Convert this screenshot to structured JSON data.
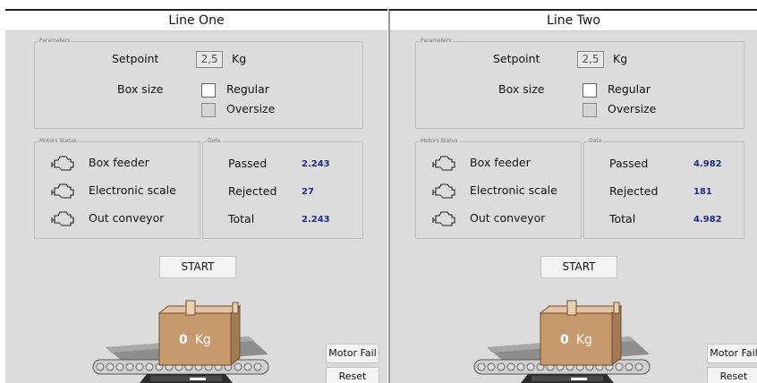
{
  "lines": [
    {
      "title": "Line One",
      "parameters_label": "Parameters",
      "setpoint_label": "Setpoint",
      "setpoint_value": "2,5",
      "setpoint_unit": "Kg",
      "box_size_label": "Box size",
      "box_options": [
        "Regular",
        "Oversize"
      ],
      "motors_label": "Motors Status",
      "motors": [
        "Box feeder",
        "Electronic scale",
        "Out conveyor"
      ],
      "motor_icon": "motor-icon",
      "data_label": "Data",
      "data_rows": [
        {
          "label": "Passed",
          "value": "2.243"
        },
        {
          "label": "Rejected",
          "value": "27"
        },
        {
          "label": "Total",
          "value": "2.243"
        }
      ],
      "start_label": "START",
      "box_weight": "0",
      "box_unit": "Kg",
      "motor_fail_label": "Motor Fail",
      "reset_label": "Reset"
    },
    {
      "title": "Line Two",
      "parameters_label": "Parameters",
      "setpoint_label": "Setpoint",
      "setpoint_value": "2,5",
      "setpoint_unit": "Kg",
      "box_size_label": "Box size",
      "box_options": [
        "Regular",
        "Oversize"
      ],
      "motors_label": "Motors Status",
      "motors": [
        "Box feeder",
        "Electronic scale",
        "Out conveyor"
      ],
      "motor_icon": "motor-icon",
      "data_label": "Data",
      "data_rows": [
        {
          "label": "Passed",
          "value": "4.982"
        },
        {
          "label": "Rejected",
          "value": "181"
        },
        {
          "label": "Total",
          "value": "4.982"
        }
      ],
      "start_label": "START",
      "box_weight": "0",
      "box_unit": "Kg",
      "motor_fail_label": "Motor Fail",
      "reset_label": "Reset"
    }
  ],
  "colors": {
    "panel_bg": "#dcdcdc",
    "data_value": "#1d2a8c",
    "box": "#c79a6e"
  }
}
